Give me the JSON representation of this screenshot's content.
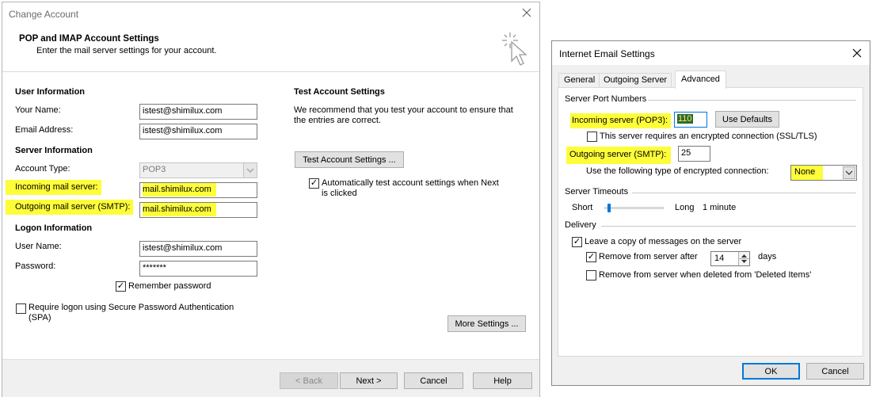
{
  "change_account": {
    "window_title": "Change Account",
    "header_title": "POP and IMAP Account Settings",
    "header_subtitle": "Enter the mail server settings for your account.",
    "user_info": {
      "heading": "User Information",
      "your_name_label": "Your Name:",
      "your_name_value": "istest@shimilux.com",
      "email_label": "Email Address:",
      "email_value": "istest@shimilux.com"
    },
    "server_info": {
      "heading": "Server Information",
      "account_type_label": "Account Type:",
      "account_type_value": "POP3",
      "incoming_label": "Incoming mail server:",
      "incoming_value": "mail.shimilux.com",
      "outgoing_label": "Outgoing mail server (SMTP):",
      "outgoing_value": "mail.shimilux.com"
    },
    "logon_info": {
      "heading": "Logon Information",
      "username_label": "User Name:",
      "username_value": "istest@shimilux.com",
      "password_label": "Password:",
      "password_value": "*******",
      "remember_password": "Remember password",
      "require_spa": "Require logon using Secure Password Authentication",
      "require_spa_2": "(SPA)"
    },
    "test_settings": {
      "heading": "Test Account Settings",
      "description_1": "We recommend that you test your account to ensure that",
      "description_2": "the entries are correct.",
      "test_button": "Test Account Settings ...",
      "auto_test_1": "Automatically test account settings when Next",
      "auto_test_2": "is clicked"
    },
    "more_settings": "More Settings ...",
    "footer": {
      "back": "< Back",
      "next": "Next >",
      "cancel": "Cancel",
      "help": "Help"
    }
  },
  "internet_email": {
    "window_title": "Internet Email Settings",
    "tabs": [
      "General",
      "Outgoing Server",
      "Advanced"
    ],
    "server_port_numbers": {
      "heading": "Server Port Numbers",
      "incoming_label": "Incoming server (POP3):",
      "incoming_value": "110",
      "use_defaults": "Use Defaults",
      "encrypted_ssl": "This server requires an encrypted connection (SSL/TLS)",
      "outgoing_label": "Outgoing server (SMTP):",
      "outgoing_value": "25",
      "encryption_type_label": "Use the following type of encrypted connection:",
      "encryption_type_value": "None"
    },
    "server_timeouts": {
      "heading": "Server Timeouts",
      "short": "Short",
      "long": "Long",
      "value": "1 minute"
    },
    "delivery": {
      "heading": "Delivery",
      "leave_copy": "Leave a copy of messages on the server",
      "remove_after": "Remove from server after",
      "remove_days_value": "14",
      "days": "days",
      "remove_deleted": "Remove from server when deleted from 'Deleted Items'"
    },
    "footer": {
      "ok": "OK",
      "cancel": "Cancel"
    }
  }
}
